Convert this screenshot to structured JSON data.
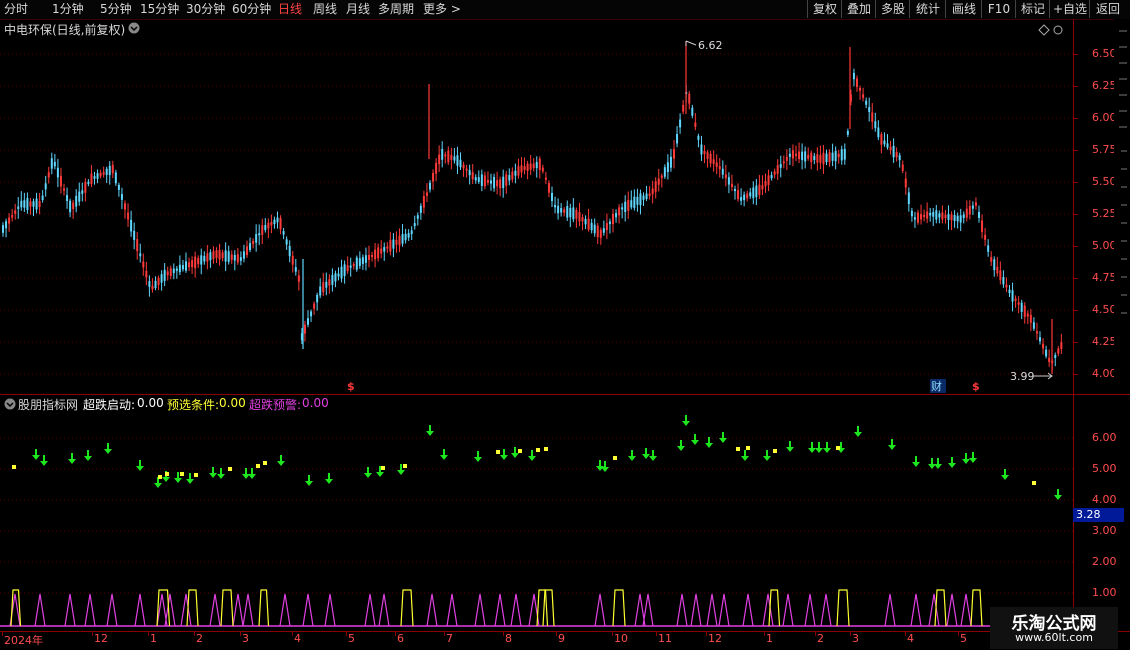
{
  "toolbar": {
    "periods": [
      "分时",
      "1分钟",
      "5分钟",
      "15分钟",
      "30分钟",
      "60分钟",
      "日线",
      "周线",
      "月线",
      "多周期",
      "更多 >"
    ],
    "active_period": "日线",
    "buttons": [
      "复权",
      "叠加",
      "多股",
      "统计",
      "画线",
      "F10",
      "标记",
      "+自选",
      "返回"
    ]
  },
  "main": {
    "title": "中电环保(日线,前复权)",
    "high_label": "6.62",
    "low_label": "3.99",
    "price_ticks": [
      "6.50",
      "6.25",
      "6.00",
      "5.75",
      "5.50",
      "5.25",
      "5.00",
      "4.75",
      "4.50",
      "4.25",
      "4.00"
    ],
    "markers": {
      "dollar1": "$",
      "cai": "财",
      "dollar2": "$"
    }
  },
  "indicator": {
    "name": "股朋指标网",
    "label1": "超跌启动:",
    "value1": "0.00",
    "label2": "预选条件:",
    "value2": "0.00",
    "label3": "超跌预警:",
    "value3": "0.00",
    "ticks": [
      "6.00",
      "5.00",
      "4.00",
      "3.00",
      "2.00",
      "1.00"
    ],
    "current_value": "3.28"
  },
  "date_axis": [
    "2024年",
    "12",
    "1",
    "2",
    "3",
    "4",
    "5",
    "6",
    "7",
    "8",
    "9",
    "10",
    "11",
    "12",
    "1",
    "2",
    "3",
    "4",
    "5"
  ],
  "watermark": {
    "title": "乐淘公式网",
    "url": "www.60lt.com"
  },
  "colors": {
    "up": "#ff3a3a",
    "down": "#5fd7ff",
    "arrow": "#1ee61e",
    "yellow": "#ffff33",
    "magenta": "#e040e0",
    "grid": "#8b0000"
  }
}
